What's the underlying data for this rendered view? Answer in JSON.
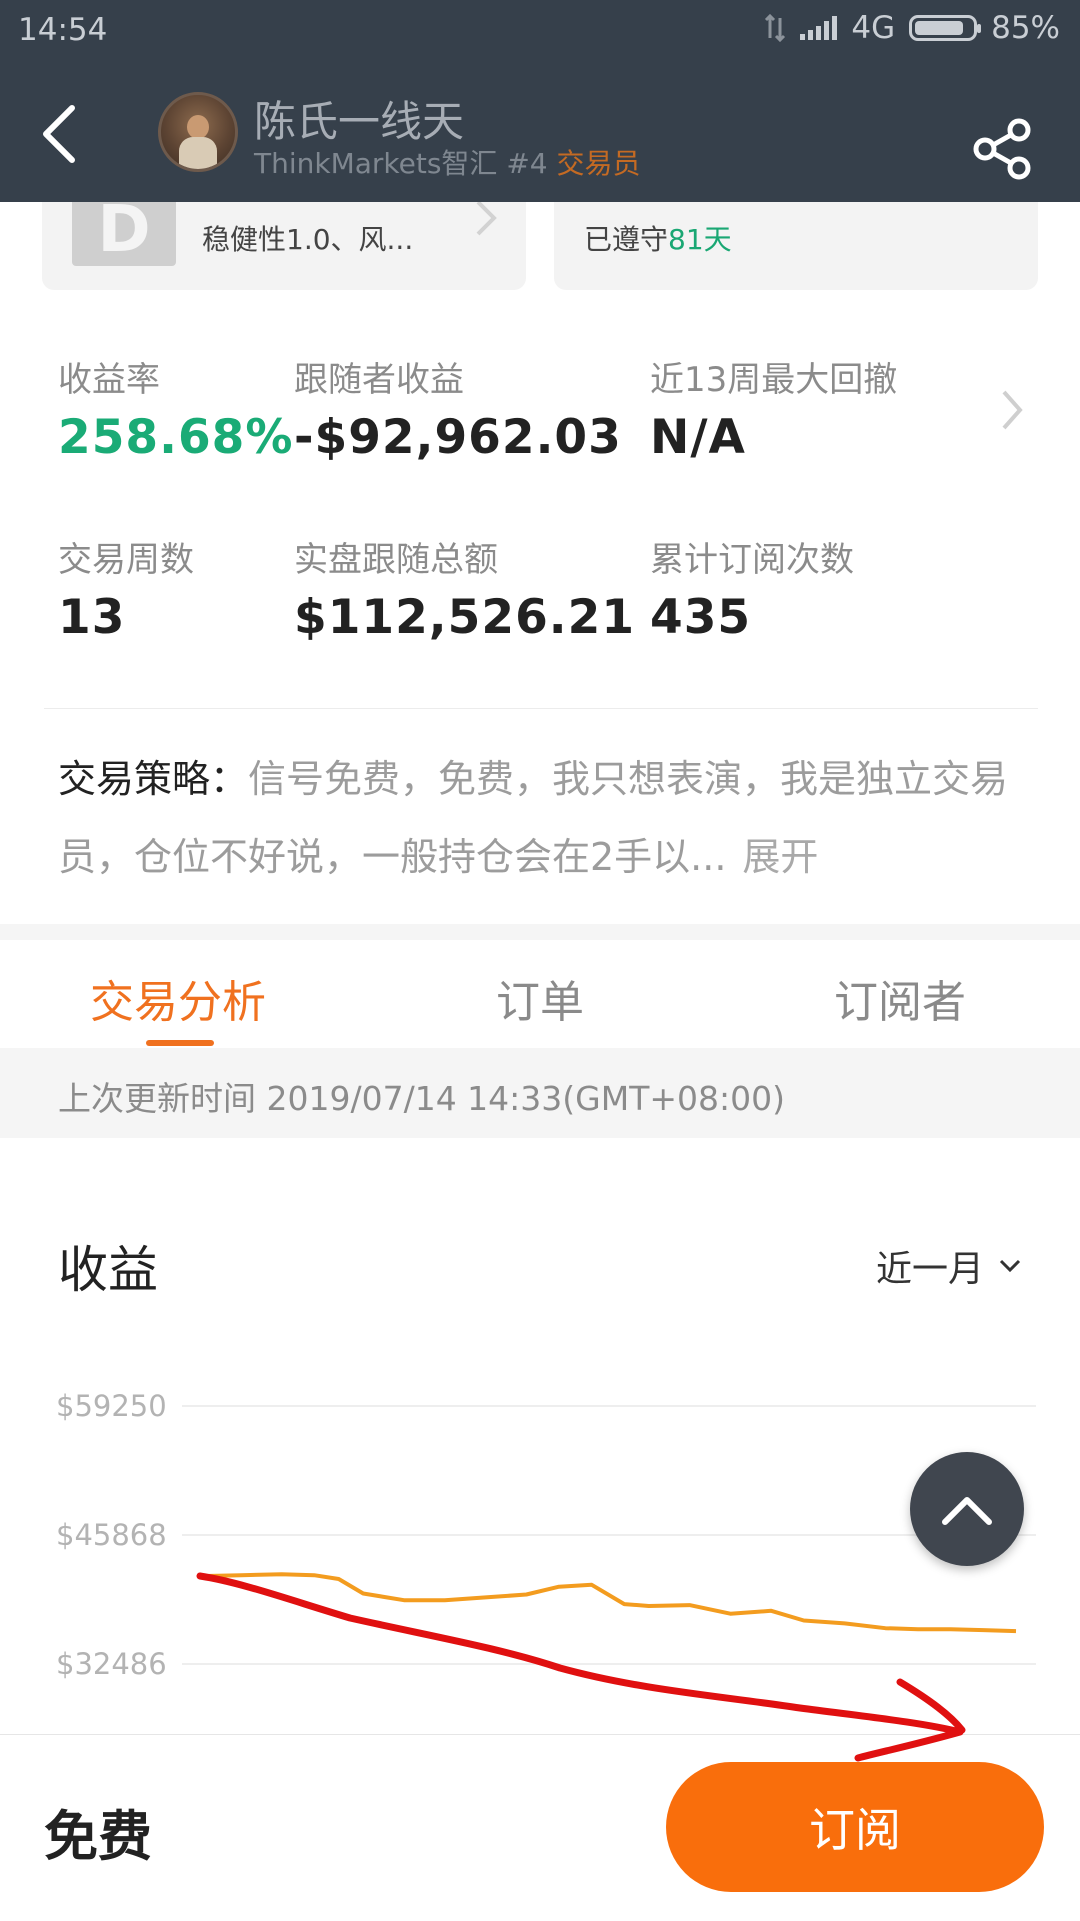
{
  "status_bar": {
    "time": "14:54",
    "network": "4G",
    "battery": "85%",
    "battery_level": 0.85
  },
  "header": {
    "trader_name": "陈氏一线天",
    "platform_rank": "ThinkMarkets智汇 #4",
    "role": "交易员"
  },
  "cards": {
    "left_text": "稳健性1.0、风...",
    "badge_letter": "D",
    "right_prefix": "已遵守",
    "right_days": "81天"
  },
  "stats": {
    "yield_label": "收益率",
    "yield_value": "258.68%",
    "follower_label": "跟随者收益",
    "follower_value": "-$92,962.03",
    "drawdown_label": "近13周最大回撤",
    "drawdown_value": "N/A",
    "weeks_label": "交易周数",
    "weeks_value": "13",
    "total_label": "实盘跟随总额",
    "total_value": "$112,526.21",
    "subs_label": "累计订阅次数",
    "subs_value": "435"
  },
  "strategy": {
    "label": "交易策略：",
    "text": "信号免费，免费，我只想表演，我是独立交易员，仓位不好说，一般持仓会在2手以...",
    "expand": "展开"
  },
  "tabs": [
    {
      "label": "交易分析",
      "active": true
    },
    {
      "label": "订单",
      "active": false
    },
    {
      "label": "订阅者",
      "active": false
    }
  ],
  "update_text": "上次更新时间 2019/07/14 14:33(GMT+08:00)",
  "earnings": {
    "title": "收益",
    "range": "近一月"
  },
  "chart_data": {
    "type": "line",
    "title": "收益",
    "y_ticks": [
      "$59250",
      "$45868",
      "$32486"
    ],
    "ylim": [
      32486,
      59250
    ],
    "series": [
      {
        "color": "#f39c1f",
        "x": [
          0,
          0.05,
          0.1,
          0.14,
          0.17,
          0.2,
          0.25,
          0.3,
          0.35,
          0.4,
          0.44,
          0.48,
          0.52,
          0.55,
          0.6,
          0.65,
          0.7,
          0.74,
          0.79,
          0.84,
          0.88,
          0.92,
          0.96,
          1.0
        ],
        "values": [
          41600,
          41700,
          41800,
          41700,
          41300,
          39800,
          39100,
          39100,
          39400,
          39700,
          40500,
          40700,
          38700,
          38500,
          38600,
          37700,
          38000,
          37000,
          36700,
          36200,
          36100,
          36100,
          36000,
          35900
        ]
      }
    ],
    "grid": true,
    "colors": {
      "line": "#f39c1f",
      "grid": "#eeeeee",
      "tick_text": "#b3b3b3"
    }
  },
  "footer": {
    "price": "免费",
    "subscribe": "订阅"
  },
  "colors": {
    "accent": "#f0711f",
    "green": "#1aa773",
    "header_bg": "#36404b",
    "button": "#f96e0c"
  }
}
